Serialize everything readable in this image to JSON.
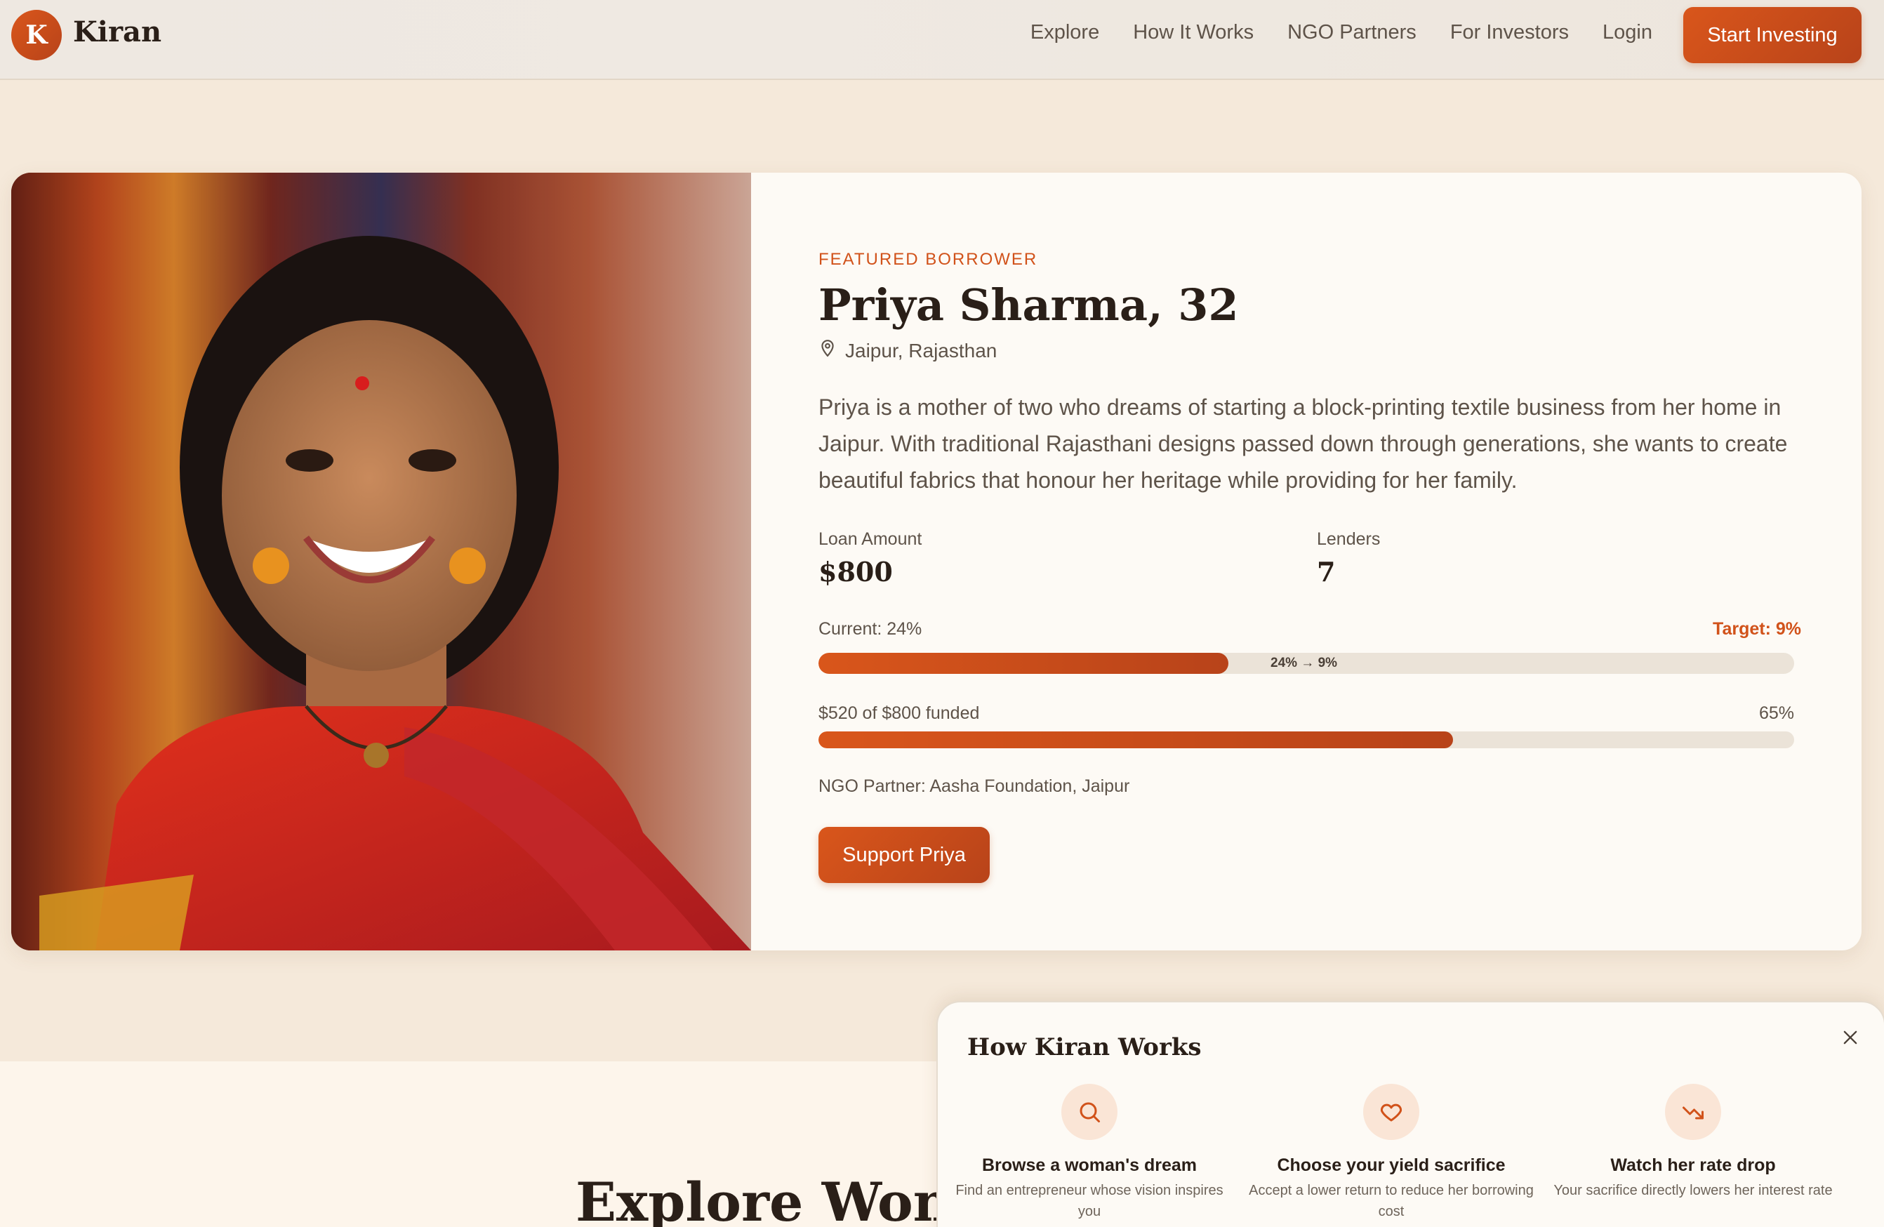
{
  "brand": {
    "logo_letter": "K",
    "name": "Kiran"
  },
  "nav": {
    "links": [
      "Explore",
      "How It Works",
      "NGO Partners",
      "For Investors",
      "Login"
    ],
    "cta": "Start Investing"
  },
  "featured": {
    "eyebrow": "FEATURED BORROWER",
    "name": "Priya Sharma, 32",
    "location": "Jaipur, Rajasthan",
    "description": "Priya is a mother of two who dreams of starting a block-printing textile business from her home in Jaipur. With traditional Rajasthani designs passed down through generations, she wants to create beautiful fabrics that honour her heritage while providing for her family.",
    "loan_label": "Loan Amount",
    "loan_value": "$800",
    "lenders_label": "Lenders",
    "lenders_value": "7",
    "rate_current": "Current: 24%",
    "rate_target": "Target: 9%",
    "rate_bar_text": "24% → 9%",
    "rate_progress_pct": 42,
    "funded_text": "$520 of $800 funded",
    "funded_pct_text": "65%",
    "funded_pct": 65,
    "ngo": "NGO Partner: Aasha Foundation, Jaipur",
    "support_button": "Support Priya"
  },
  "explore": {
    "title": "Explore Women"
  },
  "how_it_works": {
    "title": "How Kiran Works",
    "steps": [
      {
        "icon": "search-icon",
        "title": "Browse a woman's dream",
        "desc": "Find an entrepreneur whose vision inspires you"
      },
      {
        "icon": "heart-icon",
        "title": "Choose your yield sacrifice",
        "desc": "Accept a lower return to reduce her borrowing cost"
      },
      {
        "icon": "trending-down-icon",
        "title": "Watch her rate drop",
        "desc": "Your sacrifice directly lowers her interest rate"
      }
    ]
  },
  "colors": {
    "accent": "#d1521a",
    "background": "#f5e9da",
    "card": "#fdfaf5"
  }
}
